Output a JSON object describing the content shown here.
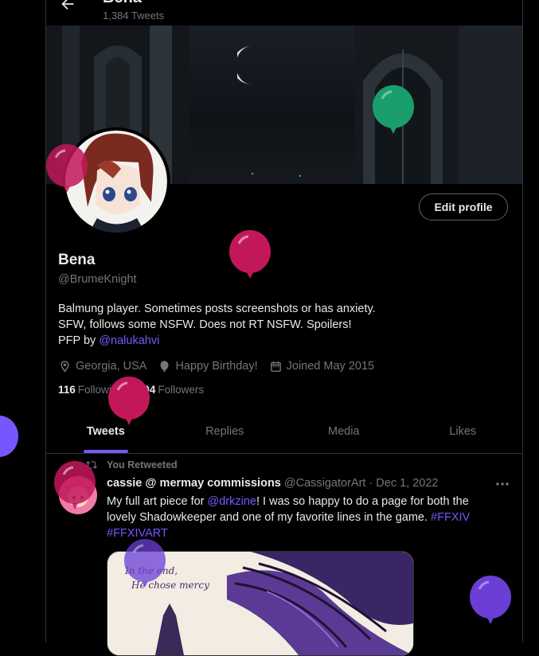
{
  "header": {
    "name": "Bena",
    "tweet_count": "1,384 Tweets"
  },
  "profile": {
    "edit_label": "Edit profile",
    "display_name": "Bena",
    "handle": "@BrumeKnight",
    "bio_line1": "Balmung player. Sometimes posts screenshots or has anxiety.",
    "bio_line2": "SFW, follows some NSFW. Does not RT NSFW. Spoilers!",
    "bio_line3_prefix": "PFP by ",
    "bio_line3_link": "@nalukahvi",
    "location": "Georgia, USA",
    "birthday": "Happy Birthday!",
    "joined": "Joined May 2015",
    "following_count": "116",
    "following_label": "Following",
    "followers_count": "104",
    "followers_label": "Followers"
  },
  "tabs": [
    {
      "label": "Tweets",
      "active": true
    },
    {
      "label": "Replies",
      "active": false
    },
    {
      "label": "Media",
      "active": false
    },
    {
      "label": "Likes",
      "active": false
    }
  ],
  "tweet": {
    "retweet_label": "You Retweeted",
    "author": "cassie @ mermay commissions",
    "handle": "@CassigatorArt",
    "separator": "·",
    "date": "Dec 1, 2022",
    "text_part1": "My full art piece for ",
    "text_mention": "@drkzine",
    "text_part2": "! I was so happy to do a page for both the lovely Shadowkeeper and one of my favorite lines in the game. ",
    "hashtag1": "#FFXIV",
    "hashtag2": "#FFXIVART",
    "media_caption_line1": "In the end,",
    "media_caption_line2": "He chose mercy"
  },
  "colors": {
    "accent": "#7856ff",
    "balloon_pink": "#c2185b",
    "balloon_green": "#1a9e6e",
    "balloon_purple": "#6b3fd6"
  },
  "icons": [
    "back-arrow-icon",
    "location-icon",
    "balloon-icon",
    "calendar-icon",
    "retweet-icon",
    "more-icon"
  ]
}
